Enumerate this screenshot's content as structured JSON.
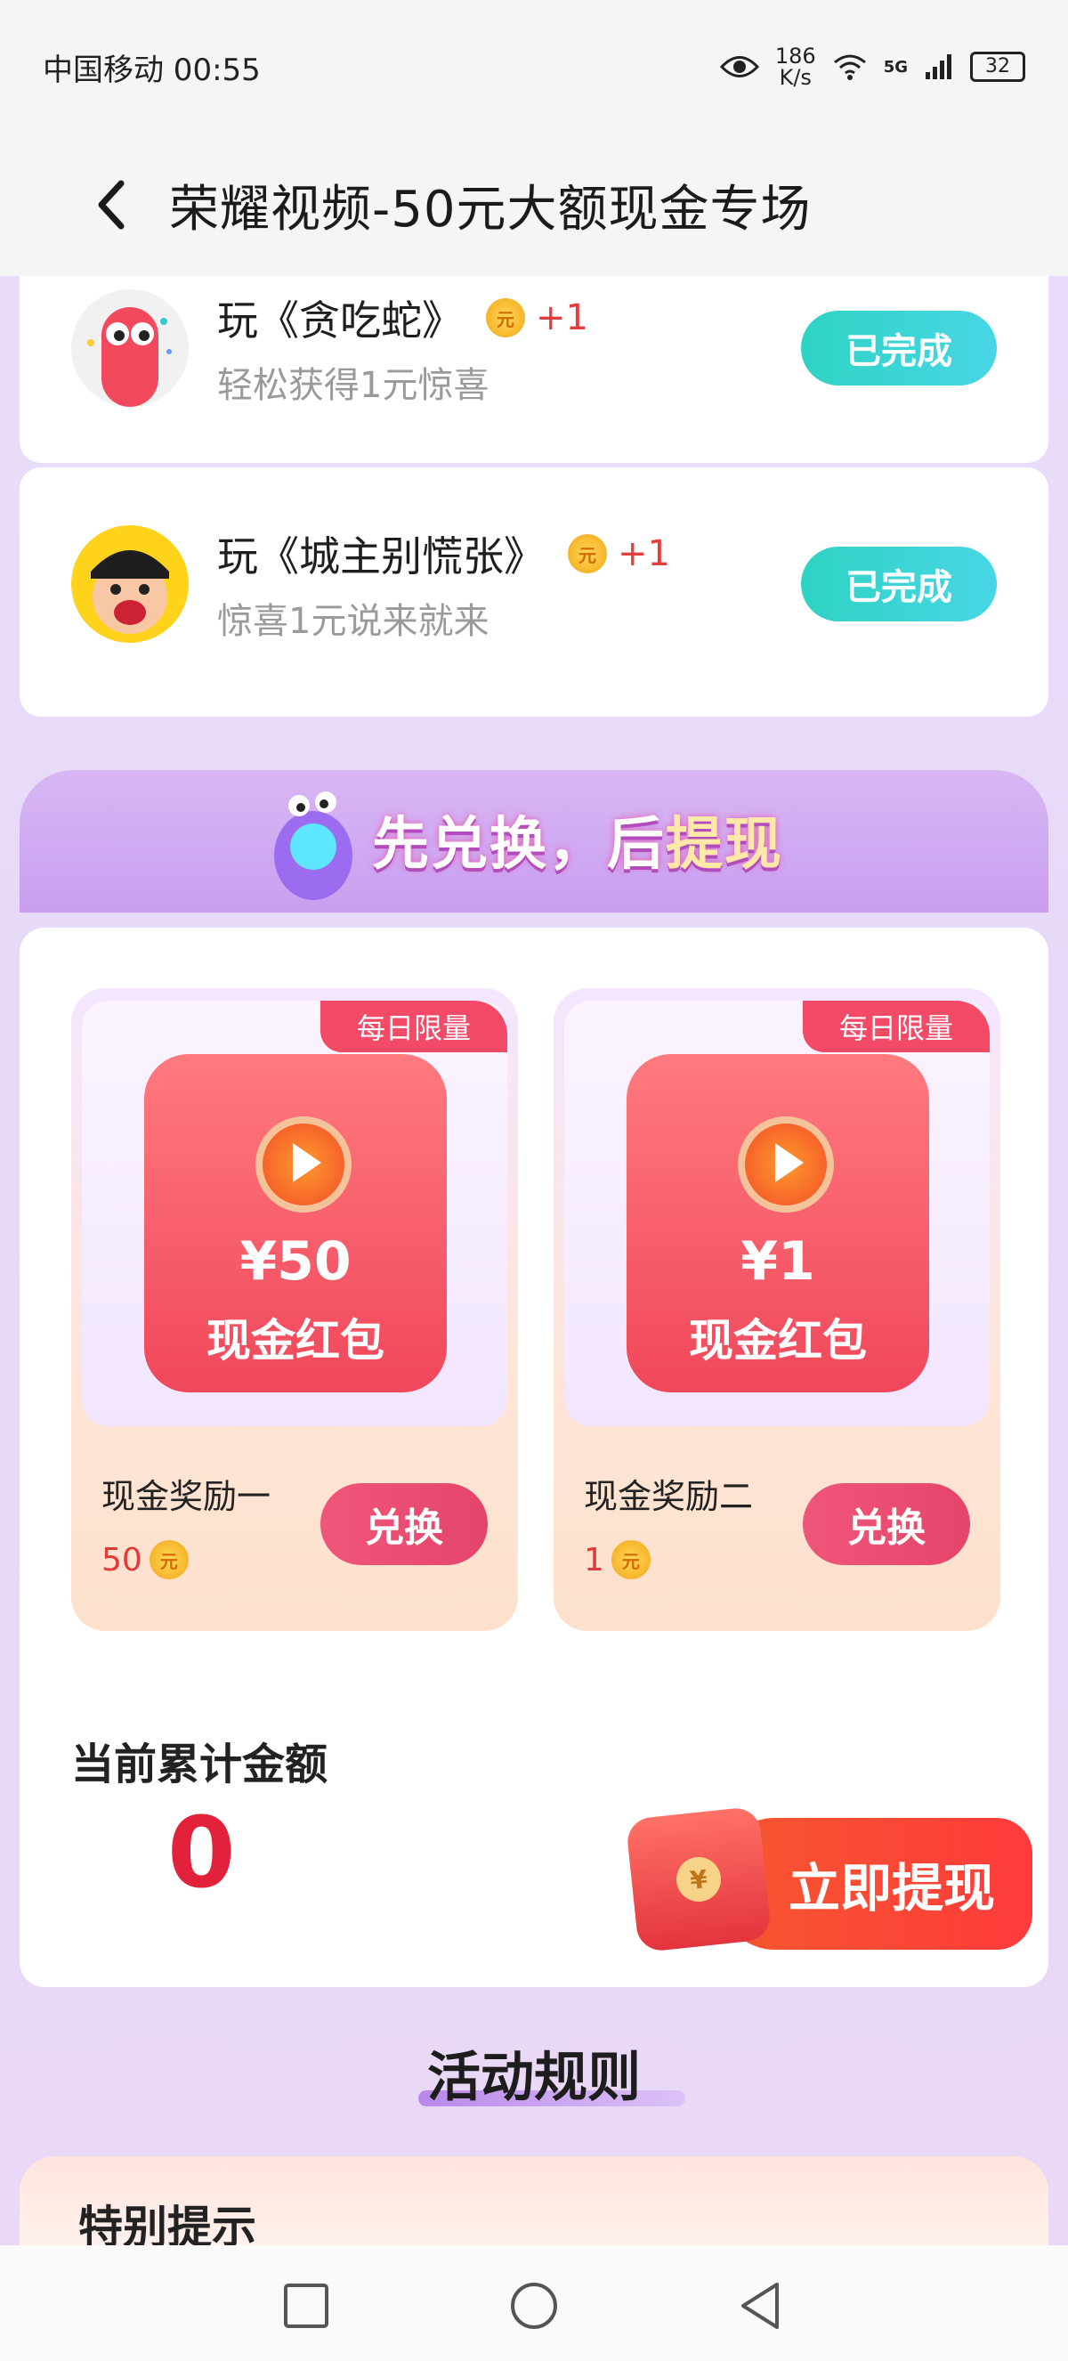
{
  "status_bar": {
    "carrier_time": "中国移动 00:55",
    "speed_value": "186",
    "speed_unit": "K/s",
    "network": "5G",
    "battery": "32"
  },
  "header": {
    "title": "荣耀视频-50元大额现金专场"
  },
  "tasks": [
    {
      "title": "玩《贪吃蛇》",
      "reward": "+1",
      "coin_label": "元",
      "subtitle": "轻松获得1元惊喜",
      "button": "已完成"
    },
    {
      "title": "玩《城主别慌张》",
      "reward": "+1",
      "coin_label": "元",
      "subtitle": "惊喜1元说来就来",
      "button": "已完成"
    }
  ],
  "banner": {
    "text_main": "先兑换，后",
    "text_highlight": "提现"
  },
  "rewards": [
    {
      "tag": "每日限量",
      "envelope_amount": "¥50",
      "envelope_label": "现金红包",
      "name": "现金奖励一",
      "cost": "50",
      "coin_label": "元",
      "button": "兑换"
    },
    {
      "tag": "每日限量",
      "envelope_amount": "¥1",
      "envelope_label": "现金红包",
      "name": "现金奖励二",
      "cost": "1",
      "coin_label": "元",
      "button": "兑换"
    }
  ],
  "total": {
    "label": "当前累计金额",
    "value": "0",
    "withdraw_button": "立即提现",
    "withdraw_coin": "¥"
  },
  "rules": {
    "title": "活动规则",
    "tip_title": "特别提示"
  },
  "colors": {
    "accent_red": "#e2223a",
    "done_button": "#2ed3c3",
    "exchange_button": "#e4456a",
    "withdraw_button": "#f5572f",
    "background": "#e9ddfa"
  },
  "icons": {
    "back": "chevron-left-icon",
    "eye": "eye-icon",
    "wifi": "wifi-icon",
    "signal": "signal-icon",
    "nav_recent": "square-icon",
    "nav_home": "circle-icon",
    "nav_back": "triangle-back-icon"
  }
}
